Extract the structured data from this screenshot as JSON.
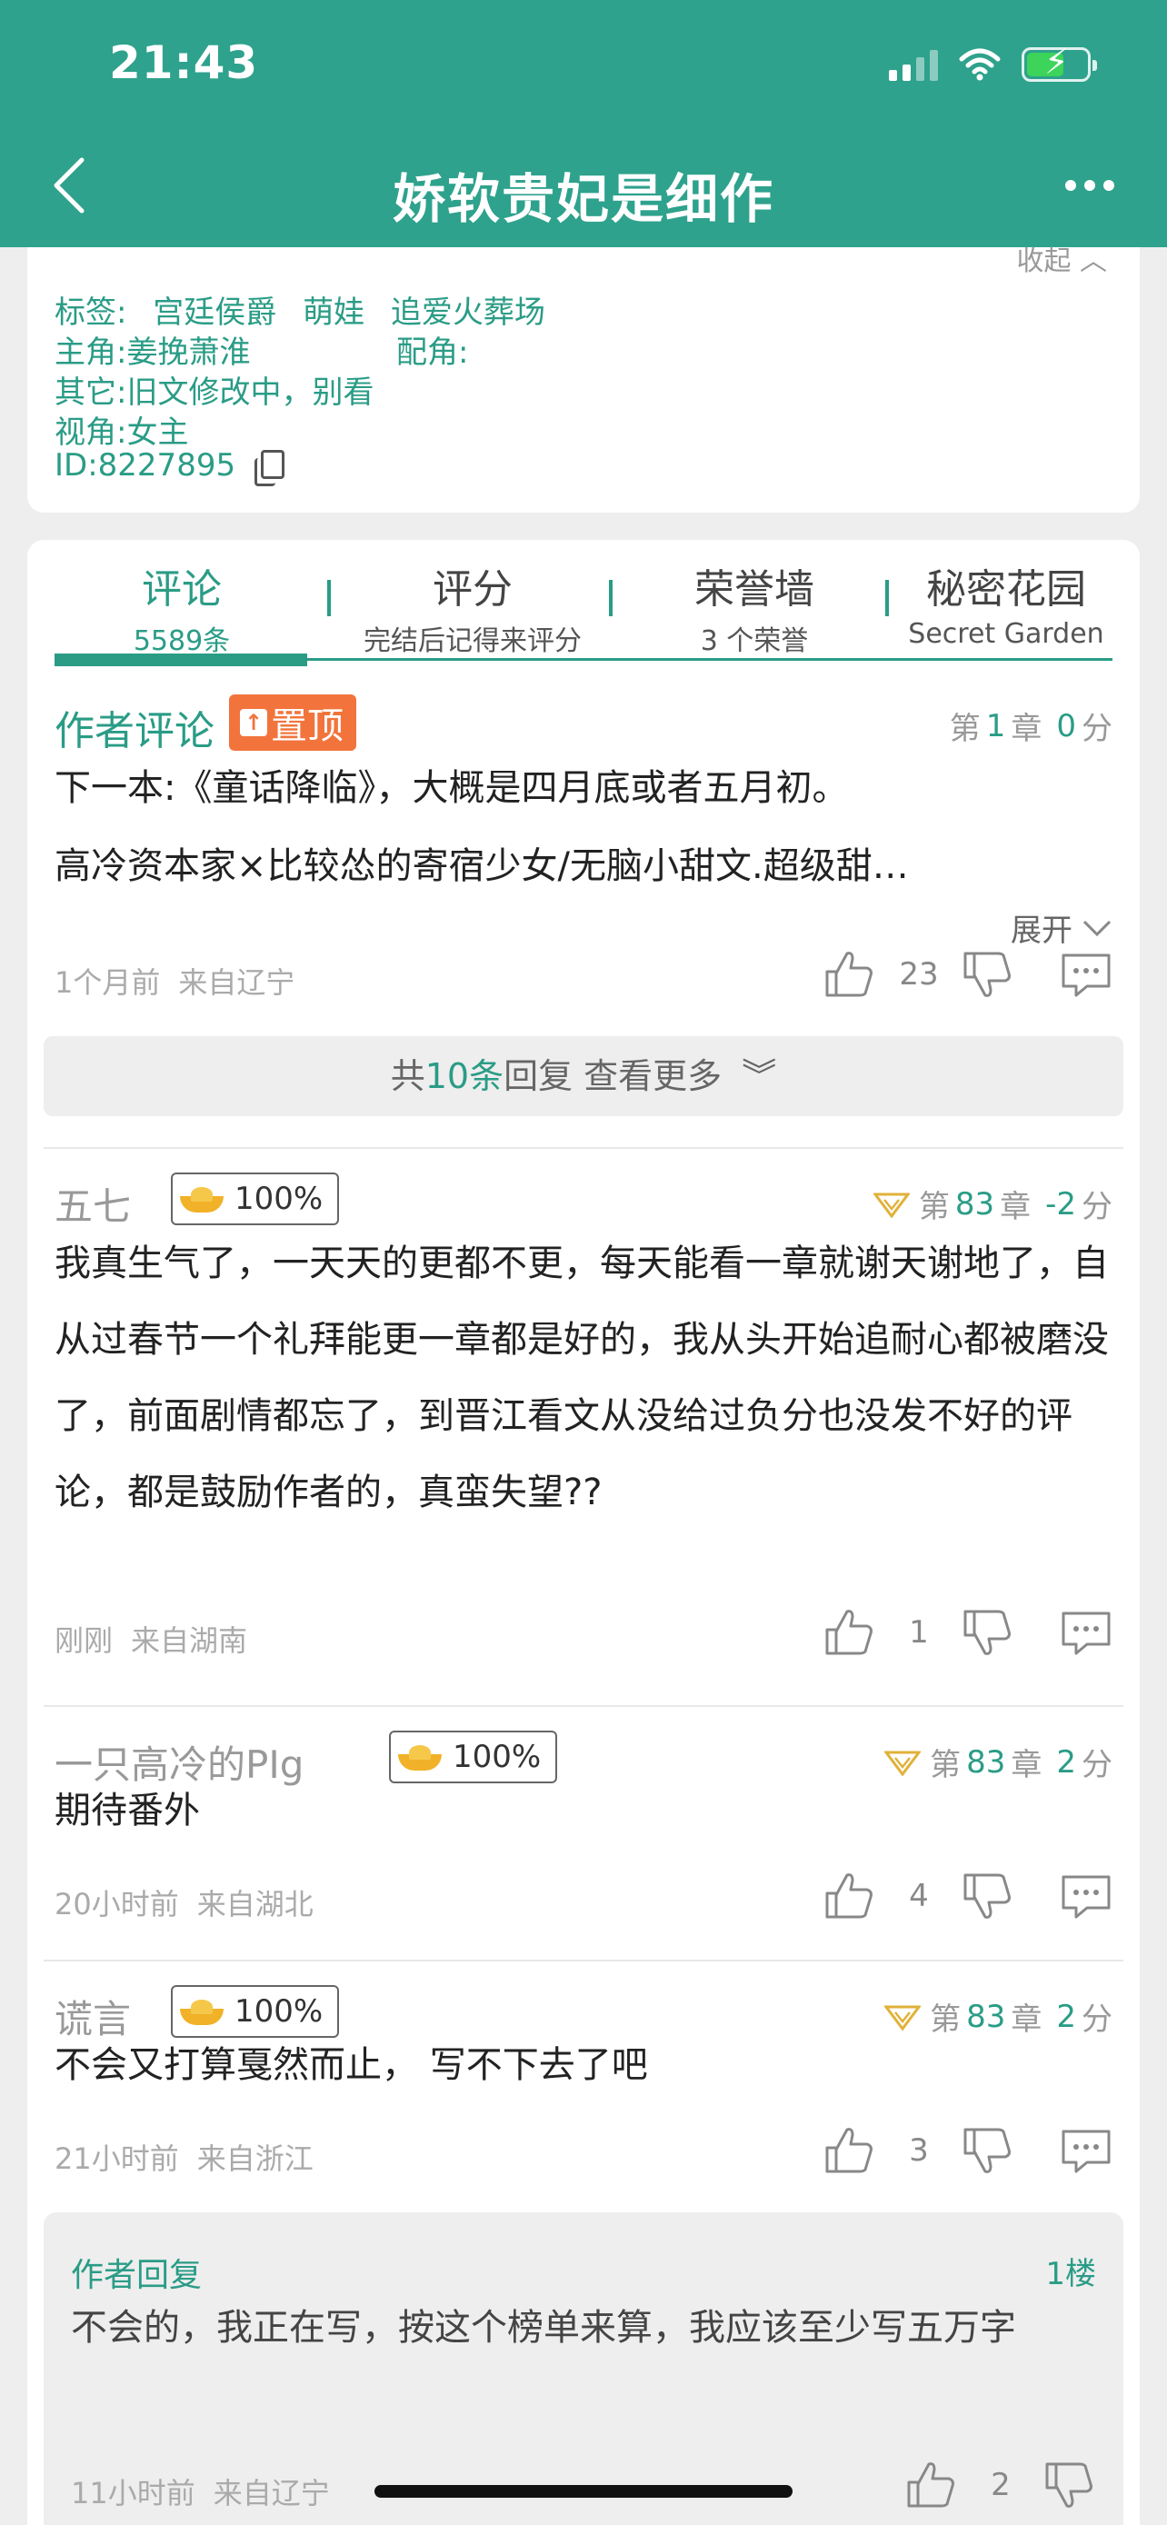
{
  "status_bar": {
    "time": "21:43"
  },
  "header": {
    "title": "娇软贵妃是细作"
  },
  "info": {
    "collapse_label": "收起",
    "tags_label": "标签:",
    "tags": [
      "宫廷侯爵",
      "萌娃",
      "追爱火葬场"
    ],
    "protagonist_label": "主角:",
    "protagonist": "姜挽萧淮",
    "supporting_label": "配角:",
    "other_label": "其它:",
    "other": "旧文修改中，别看",
    "pov_label": "视角:",
    "pov": "女主",
    "id_text": "ID:8227895"
  },
  "tabs": [
    {
      "label": "评论",
      "sub": "5589条"
    },
    {
      "label": "评分",
      "sub": "完结后记得来评分"
    },
    {
      "label": "荣誉墙",
      "sub": "3 个荣誉"
    },
    {
      "label": "秘密花园",
      "sub": "Secret Garden"
    }
  ],
  "pinned": {
    "author": "作者评论",
    "badge": "置顶",
    "chapter_prefix": "第",
    "chapter_num": "1",
    "chapter_suffix": "章",
    "score_num": "0",
    "score_suffix": "分",
    "line1": "下一本:《童话降临》，大概是四月底或者五月初。",
    "line2": "高冷资本家×比较怂的寄宿少女/无脑小甜文.超级甜…",
    "expand": "展开",
    "time": "1个月前",
    "location": "来自辽宁",
    "likes": "23"
  },
  "more_replies": {
    "prefix": "共",
    "num": "10条",
    "suffix": "回复 查看更多"
  },
  "comments": [
    {
      "author": "五七",
      "percent": "100%",
      "chapter_prefix": "第",
      "chapter_num": "83",
      "chapter_suffix": "章",
      "score_num": "-2",
      "score_suffix": "分",
      "text": "我真生气了，一天天的更都不更，每天能看一章就谢天谢地了，自从过春节一个礼拜能更一章都是好的，我从头开始追耐心都被磨没了，前面剧情都忘了，到晋江看文从没给过负分也没发不好的评论，都是鼓励作者的，真蛮失望??",
      "time": "刚刚",
      "location": "来自湖南",
      "likes": "1"
    },
    {
      "author": "一只高冷的PIg",
      "percent": "100%",
      "chapter_prefix": "第",
      "chapter_num": "83",
      "chapter_suffix": "章",
      "score_num": "2",
      "score_suffix": "分",
      "text": "期待番外",
      "time": "20小时前",
      "location": "来自湖北",
      "likes": "4"
    },
    {
      "author": "谎言",
      "percent": "100%",
      "chapter_prefix": "第",
      "chapter_num": "83",
      "chapter_suffix": "章",
      "score_num": "2",
      "score_suffix": "分",
      "text": "不会又打算戛然而止， 写不下去了吧",
      "time": "21小时前",
      "location": "来自浙江",
      "likes": "3"
    }
  ],
  "author_reply": {
    "title": "作者回复",
    "floor": "1楼",
    "text": "不会的，我正在写，按这个榜单来算，我应该至少写五万字",
    "time": "11小时前",
    "location": "来自辽宁",
    "likes": "2"
  },
  "colors": {
    "primary": "#2ea28c",
    "accent_text": "#2a9c86",
    "pin_badge": "#f2743c"
  }
}
